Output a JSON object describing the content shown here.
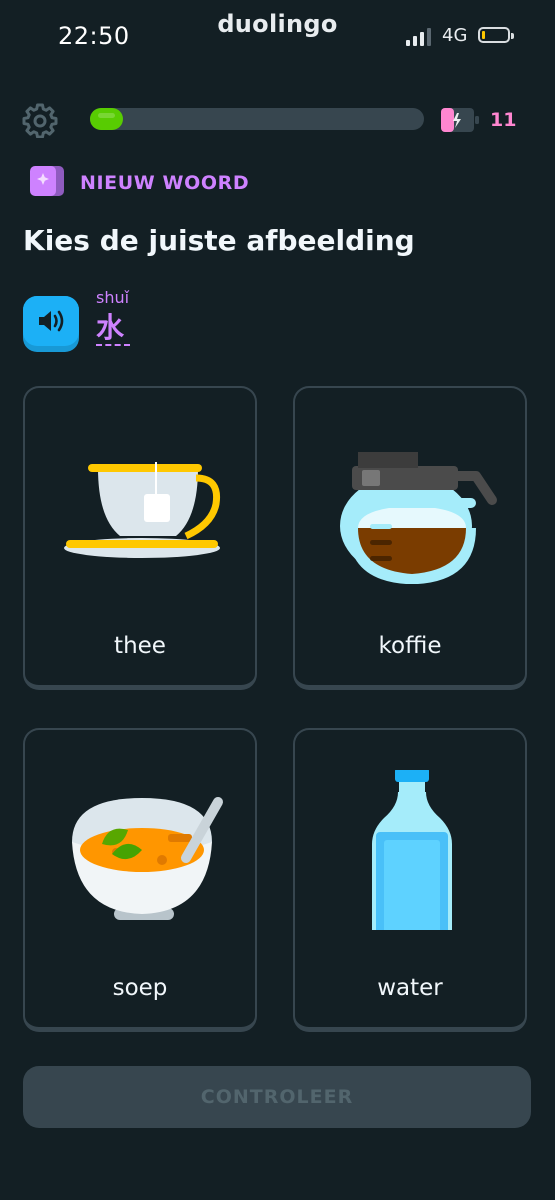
{
  "status_bar": {
    "time": "22:50",
    "app_name": "duolingo",
    "network": "4G",
    "battery_level_fraction": 0.1
  },
  "header": {
    "progress_fraction": 0.1,
    "energy_count": "11",
    "icons": {
      "settings": "gear-icon",
      "energy": "energy-battery-icon"
    }
  },
  "lesson": {
    "badge": "NIEUW WOORD",
    "prompt": "Kies de juiste afbeelding",
    "word_pinyin": "shuǐ",
    "word": "水"
  },
  "options": [
    {
      "label": "thee",
      "icon": "tea-cup-icon"
    },
    {
      "label": "koffie",
      "icon": "coffee-pot-icon"
    },
    {
      "label": "soep",
      "icon": "soup-bowl-icon"
    },
    {
      "label": "water",
      "icon": "water-bottle-icon"
    }
  ],
  "footer": {
    "check_label": "CONTROLEER"
  },
  "colors": {
    "background": "#131f24",
    "progress": "#58cc02",
    "accent_purple": "#ce82ff",
    "accent_pink": "#ff86d0",
    "speaker": "#1cb0f6",
    "card_border": "#37464f"
  }
}
